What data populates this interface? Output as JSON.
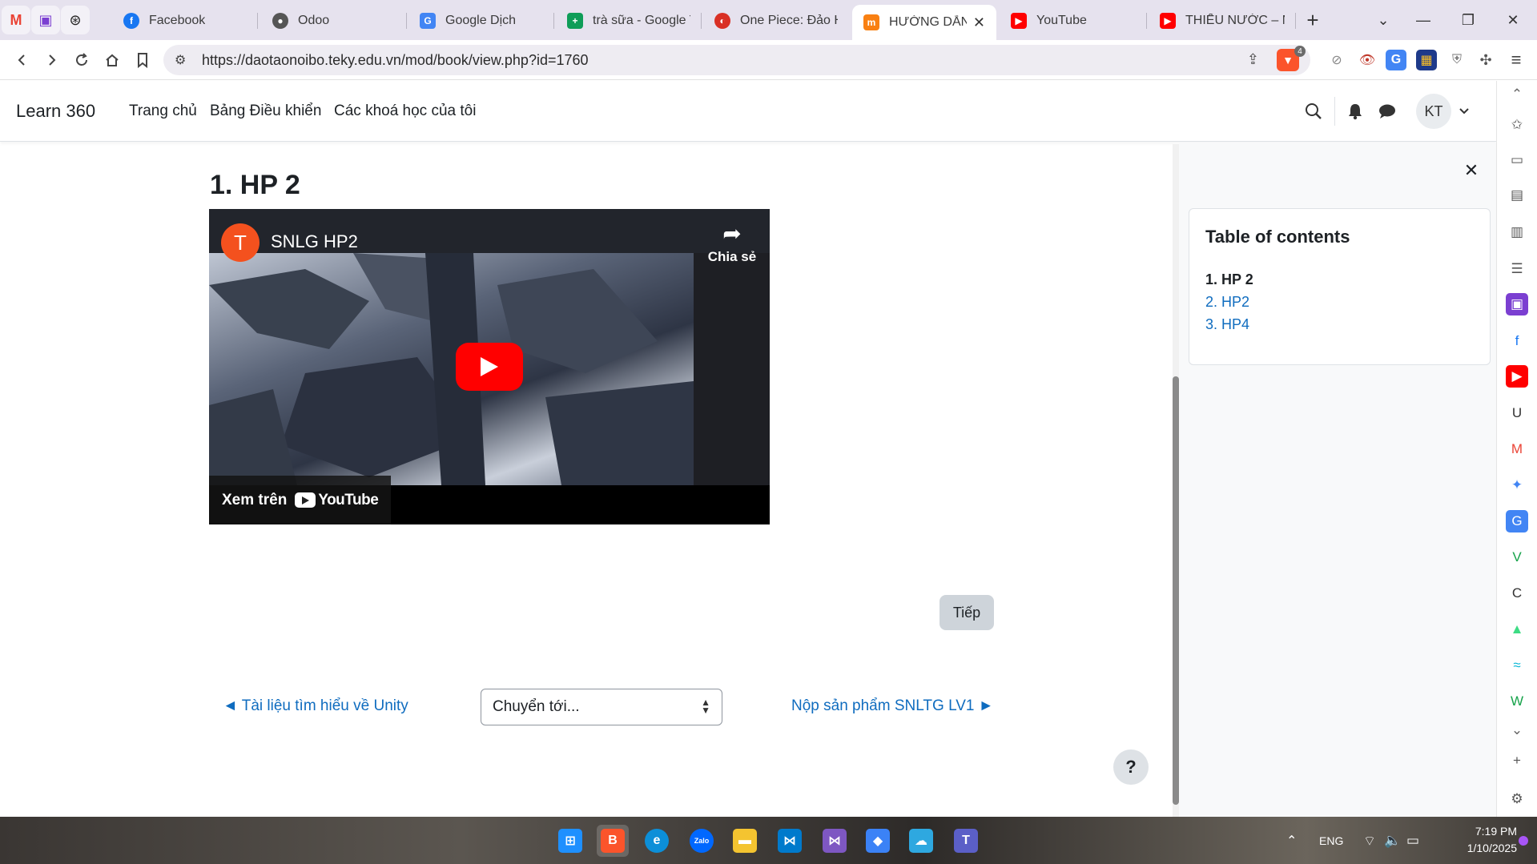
{
  "browser": {
    "pinned_tabs": [
      {
        "icon": "gmail-icon",
        "glyph": "M",
        "color": "#ea4335"
      },
      {
        "icon": "contacts-icon",
        "glyph": "▣",
        "color": "#7b3fd1"
      },
      {
        "icon": "chatgpt-icon",
        "glyph": "⊛",
        "color": "#222222"
      }
    ],
    "tabs": [
      {
        "label": "Facebook",
        "icon": "facebook-icon",
        "glyph": "f",
        "color": "#1877f2"
      },
      {
        "label": "Odoo",
        "icon": "odoo-icon",
        "glyph": "●",
        "color": "#555555"
      },
      {
        "label": "Google Dịch",
        "icon": "google-translate-icon",
        "glyph": "G",
        "color": "#4285f4"
      },
      {
        "label": "trà sữa - Google Tr",
        "icon": "google-sheets-icon",
        "glyph": "+",
        "color": "#0f9d58"
      },
      {
        "label": "One Piece: Đảo Hả",
        "icon": "onepiece-icon",
        "glyph": "◐",
        "color": "#d93025"
      },
      {
        "label": "HƯỚNG DẪN",
        "icon": "moodle-icon",
        "glyph": "m",
        "color": "#f98012",
        "active": true
      },
      {
        "label": "YouTube",
        "icon": "youtube-icon",
        "glyph": "▶",
        "color": "#ff0000"
      },
      {
        "label": "THIẾU NƯỚC – NG",
        "icon": "youtube-icon",
        "glyph": "▶",
        "color": "#ff0000"
      }
    ],
    "new_tab": "+",
    "tab_search": "⌄",
    "window_controls": {
      "minimize": "—",
      "restore": "❐",
      "close": "✕"
    },
    "url": "https://daotaonoibo.teky.edu.vn/mod/book/view.php?id=1760",
    "shields_count": "4",
    "extensions": [
      {
        "icon": "compass-icon",
        "glyph": "⊘",
        "color": "#888888"
      },
      {
        "icon": "eye-extension-icon",
        "glyph": "👁",
        "color": "#c0392b"
      },
      {
        "icon": "translate-extension-icon",
        "glyph": "G",
        "color": "#4285f4"
      },
      {
        "icon": "image-extension-icon",
        "glyph": "▦",
        "color": "#1e3a8a"
      },
      {
        "icon": "shield-extension-icon",
        "glyph": "⛨",
        "color": "#777777"
      },
      {
        "icon": "puzzle-icon",
        "glyph": "✣",
        "color": "#555555"
      },
      {
        "icon": "menu-icon",
        "glyph": "≡",
        "color": "#444444"
      }
    ]
  },
  "site": {
    "brand": "Learn 360",
    "nav": [
      "Trang chủ",
      "Bảng Điều khiển",
      "Các khoá học của tôi"
    ],
    "user_initials": "KT"
  },
  "main": {
    "chapter_title": "1. HP 2",
    "video": {
      "channel_initial": "T",
      "title": "SNLG HP2",
      "share_label": "Chia sẻ",
      "watch_on": "Xem trên",
      "youtube_wordmark": "YouTube"
    },
    "next_button": "Tiếp",
    "prev_activity": "◄ Tài liệu tìm hiểu về Unity",
    "jump_to": "Chuyển tới...",
    "next_activity": "Nộp sản phẩm SNLTG LV1 ►",
    "help": "?"
  },
  "drawer": {
    "close": "✕",
    "toc_title": "Table of contents",
    "toc_items": [
      {
        "label": "1. HP 2",
        "current": true
      },
      {
        "label": "2. HP2",
        "current": false
      },
      {
        "label": "3. HP4",
        "current": false
      }
    ]
  },
  "browser_sidebar": [
    {
      "icon": "chevron-up-icon",
      "glyph": "⌃",
      "color": "#666666"
    },
    {
      "icon": "leo-ai-icon",
      "glyph": "✩",
      "color": "#555555"
    },
    {
      "icon": "reading-list-icon",
      "glyph": "▭",
      "color": "#555555"
    },
    {
      "icon": "wallet-icon",
      "glyph": "▤",
      "color": "#555555"
    },
    {
      "icon": "bookmarks-icon",
      "glyph": "▥",
      "color": "#555555"
    },
    {
      "icon": "reader-icon",
      "glyph": "☰",
      "color": "#555555"
    },
    {
      "icon": "contacts-icon",
      "glyph": "▣",
      "color": "#7b3fd1"
    },
    {
      "icon": "facebook-icon",
      "glyph": "f",
      "color": "#1877f2"
    },
    {
      "icon": "youtube-icon",
      "glyph": "▶",
      "color": "#ff0000"
    },
    {
      "icon": "u-icon",
      "glyph": "U",
      "color": "#333333"
    },
    {
      "icon": "gmail-icon",
      "glyph": "M",
      "color": "#ea4335"
    },
    {
      "icon": "gemini-icon",
      "glyph": "✦",
      "color": "#4285f4"
    },
    {
      "icon": "google-translate-icon",
      "glyph": "G",
      "color": "#4285f4"
    },
    {
      "icon": "vector-icon",
      "glyph": "V",
      "color": "#16a34a"
    },
    {
      "icon": "c-icon",
      "glyph": "C",
      "color": "#333333"
    },
    {
      "icon": "android-icon",
      "glyph": "▲",
      "color": "#3ddc84"
    },
    {
      "icon": "tailwind-icon",
      "glyph": "≈",
      "color": "#06b6d4"
    },
    {
      "icon": "w-icon",
      "glyph": "W",
      "color": "#16a34a"
    },
    {
      "icon": "chevron-down-icon",
      "glyph": "⌄",
      "color": "#666666"
    },
    {
      "icon": "plus-icon",
      "glyph": "+",
      "color": "#555555"
    },
    {
      "icon": "settings-icon",
      "glyph": "⚙",
      "color": "#555555"
    }
  ],
  "taskbar": {
    "apps": [
      {
        "icon": "windows-start-icon",
        "glyph": "⊞",
        "color": "#1e90ff"
      },
      {
        "icon": "brave-icon",
        "glyph": "B",
        "color": "#fb542b"
      },
      {
        "icon": "edge-icon",
        "glyph": "e",
        "color": "#0c8fd8"
      },
      {
        "icon": "zalo-icon",
        "glyph": "Zalo",
        "color": "#0068ff"
      },
      {
        "icon": "file-explorer-icon",
        "glyph": "▬",
        "color": "#f4c430"
      },
      {
        "icon": "vscode-icon",
        "glyph": "⋈",
        "color": "#007acc"
      },
      {
        "icon": "visual-studio-icon",
        "glyph": "⋈",
        "color": "#7e57c2"
      },
      {
        "icon": "copilot-icon",
        "glyph": "◆",
        "color": "#3b82f6"
      },
      {
        "icon": "azure-icon",
        "glyph": "☁",
        "color": "#2ea8e0"
      },
      {
        "icon": "teams-icon",
        "glyph": "T",
        "color": "#5b5fc7"
      }
    ],
    "tray_chevron": "⌃",
    "language": "ENG",
    "time": "7:19 PM",
    "date": "1/10/2025"
  }
}
